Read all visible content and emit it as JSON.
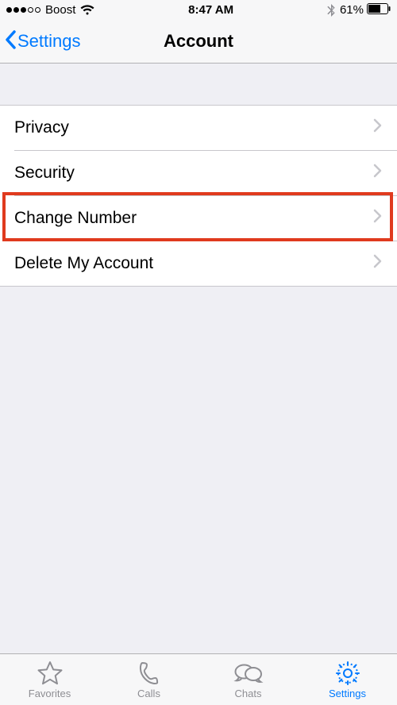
{
  "status": {
    "carrier": "Boost",
    "time": "8:47 AM",
    "battery_pct": "61%",
    "signal_filled": 3,
    "signal_total": 5
  },
  "nav": {
    "back_label": "Settings",
    "title": "Account"
  },
  "rows": {
    "privacy": "Privacy",
    "security": "Security",
    "change_number": "Change Number",
    "delete_account": "Delete My Account"
  },
  "tabs": {
    "favorites": "Favorites",
    "calls": "Calls",
    "chats": "Chats",
    "settings": "Settings"
  },
  "colors": {
    "accent": "#007aff",
    "highlight": "#e03a1e"
  }
}
